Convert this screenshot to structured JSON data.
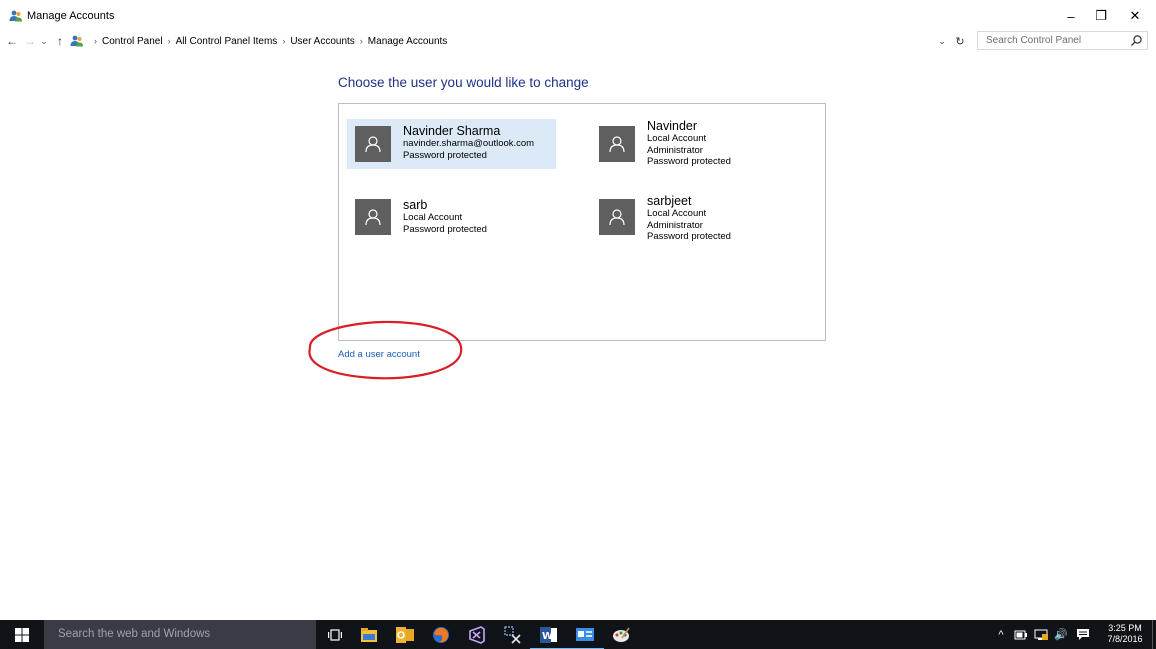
{
  "window": {
    "title": "Manage Accounts",
    "controls": {
      "minimize": "–",
      "restore": "❐",
      "close": "✕"
    }
  },
  "addressbar": {
    "back": "←",
    "forward": "→",
    "recent": "⌄",
    "up": "↑",
    "breadcrumbs": [
      "Control Panel",
      "All Control Panel Items",
      "User Accounts",
      "Manage Accounts"
    ],
    "separator": "›",
    "dropdown": "⌄",
    "refresh": "↻",
    "search_placeholder": "Search Control Panel"
  },
  "main": {
    "heading": "Choose the user you would like to change",
    "accounts": [
      {
        "name": "Navinder Sharma",
        "lines": [
          "navinder.sharma@outlook.com",
          "Password protected"
        ],
        "selected": true
      },
      {
        "name": "Navinder",
        "lines": [
          "Local Account",
          "Administrator",
          "Password protected"
        ],
        "selected": false
      },
      {
        "name": "sarb",
        "lines": [
          "Local Account",
          "Password protected"
        ],
        "selected": false
      },
      {
        "name": "sarbjeet",
        "lines": [
          "Local Account",
          "Administrator",
          "Password protected"
        ],
        "selected": false
      }
    ],
    "add_link": "Add a user account",
    "highlight_color": "#d91f26"
  },
  "taskbar": {
    "search_placeholder": "Search the web and Windows",
    "apps": [
      "task-view-icon",
      "file-explorer-icon",
      "outlook-icon",
      "firefox-icon",
      "visual-studio-icon",
      "snipping-tool-icon",
      "word-icon",
      "control-panel-icon",
      "paint-icon"
    ],
    "tray": {
      "chevron": "^",
      "volume": "🔊"
    },
    "clock": {
      "time": "3:25 PM",
      "date": "7/8/2016"
    }
  },
  "colors": {
    "heading": "#1e3287",
    "link": "#1a5bb5",
    "selected_bg": "#dceaf7",
    "avatar_bg": "#5f5f5f",
    "taskbar_bg": "#101419"
  }
}
